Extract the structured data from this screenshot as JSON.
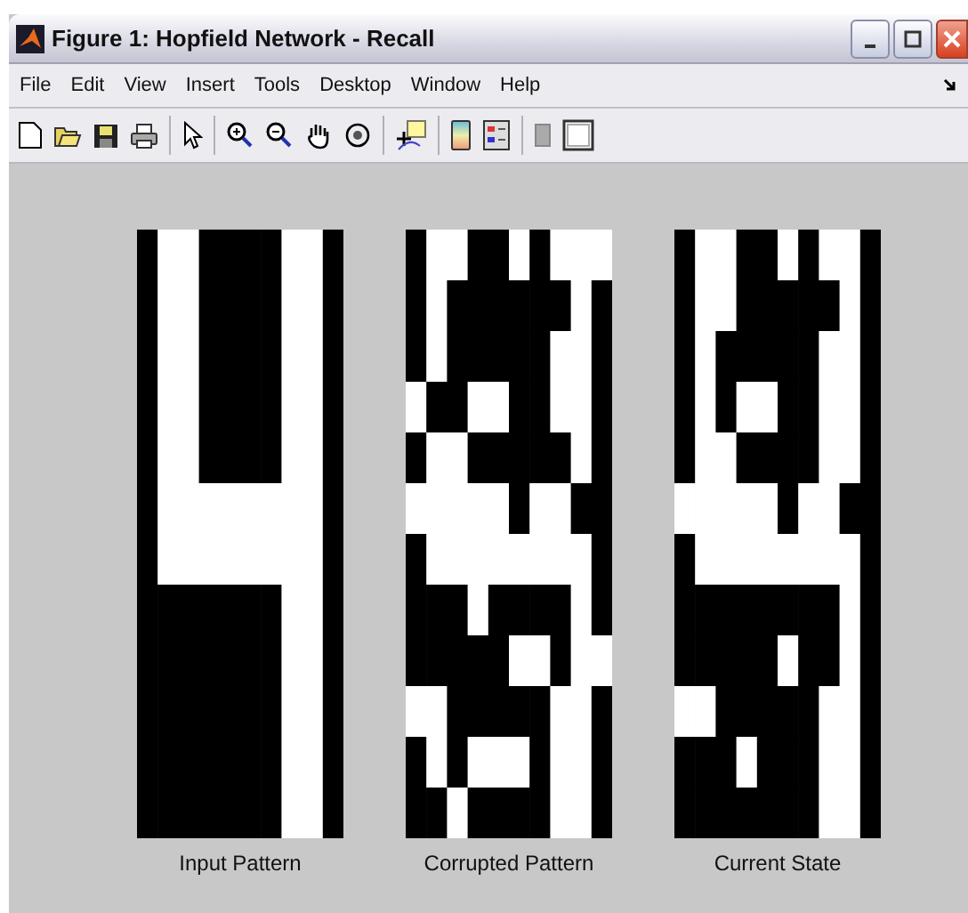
{
  "window": {
    "title": "Figure 1: Hopfield Network - Recall"
  },
  "menu": [
    "File",
    "Edit",
    "View",
    "Insert",
    "Tools",
    "Desktop",
    "Window",
    "Help"
  ],
  "patterns": [
    {
      "label": "Input Pattern",
      "pixels": [
        [
          false,
          true,
          true,
          false,
          false,
          false,
          false,
          true,
          true,
          false
        ],
        [
          false,
          true,
          true,
          false,
          false,
          false,
          false,
          true,
          true,
          false
        ],
        [
          false,
          true,
          true,
          false,
          false,
          false,
          false,
          true,
          true,
          false
        ],
        [
          false,
          true,
          true,
          false,
          false,
          false,
          false,
          true,
          true,
          false
        ],
        [
          false,
          true,
          true,
          false,
          false,
          false,
          false,
          true,
          true,
          false
        ],
        [
          false,
          true,
          true,
          true,
          true,
          true,
          true,
          true,
          true,
          false
        ],
        [
          false,
          true,
          true,
          true,
          true,
          true,
          true,
          true,
          true,
          false
        ],
        [
          false,
          false,
          false,
          false,
          false,
          false,
          false,
          true,
          true,
          false
        ],
        [
          false,
          false,
          false,
          false,
          false,
          false,
          false,
          true,
          true,
          false
        ],
        [
          false,
          false,
          false,
          false,
          false,
          false,
          false,
          true,
          true,
          false
        ],
        [
          false,
          false,
          false,
          false,
          false,
          false,
          false,
          true,
          true,
          false
        ],
        [
          false,
          false,
          false,
          false,
          false,
          false,
          false,
          true,
          true,
          false
        ]
      ]
    },
    {
      "label": "Corrupted Pattern",
      "pixels": [
        [
          false,
          true,
          true,
          false,
          false,
          true,
          false,
          true,
          true,
          true
        ],
        [
          false,
          true,
          false,
          false,
          false,
          false,
          false,
          false,
          true,
          false
        ],
        [
          false,
          true,
          false,
          false,
          false,
          false,
          false,
          true,
          true,
          false
        ],
        [
          true,
          false,
          false,
          true,
          true,
          false,
          false,
          true,
          true,
          false
        ],
        [
          false,
          true,
          true,
          false,
          false,
          false,
          false,
          false,
          true,
          false
        ],
        [
          true,
          true,
          true,
          true,
          true,
          false,
          true,
          true,
          false,
          false
        ],
        [
          false,
          true,
          true,
          true,
          true,
          true,
          true,
          true,
          true,
          false
        ],
        [
          false,
          false,
          false,
          true,
          false,
          false,
          false,
          false,
          true,
          false
        ],
        [
          false,
          false,
          false,
          false,
          false,
          true,
          true,
          false,
          true,
          true
        ],
        [
          true,
          true,
          false,
          false,
          false,
          false,
          false,
          true,
          true,
          false
        ],
        [
          false,
          true,
          false,
          true,
          true,
          true,
          false,
          true,
          true,
          false
        ],
        [
          false,
          false,
          true,
          false,
          false,
          false,
          false,
          true,
          true,
          false
        ]
      ]
    },
    {
      "label": "Current State",
      "pixels": [
        [
          false,
          true,
          true,
          false,
          false,
          true,
          false,
          true,
          true,
          false
        ],
        [
          false,
          true,
          true,
          false,
          false,
          false,
          false,
          false,
          true,
          false
        ],
        [
          false,
          true,
          false,
          false,
          false,
          false,
          false,
          true,
          true,
          false
        ],
        [
          false,
          true,
          false,
          true,
          true,
          false,
          false,
          true,
          true,
          false
        ],
        [
          false,
          true,
          true,
          false,
          false,
          false,
          false,
          true,
          true,
          false
        ],
        [
          true,
          true,
          true,
          true,
          true,
          false,
          true,
          true,
          false,
          false
        ],
        [
          false,
          true,
          true,
          true,
          true,
          true,
          true,
          true,
          true,
          false
        ],
        [
          false,
          false,
          false,
          false,
          false,
          false,
          false,
          false,
          true,
          false
        ],
        [
          false,
          false,
          false,
          false,
          false,
          true,
          false,
          false,
          true,
          false
        ],
        [
          true,
          true,
          false,
          false,
          false,
          false,
          false,
          true,
          true,
          false
        ],
        [
          false,
          false,
          false,
          true,
          false,
          false,
          false,
          true,
          true,
          false
        ],
        [
          false,
          false,
          false,
          false,
          false,
          false,
          false,
          true,
          true,
          false
        ]
      ]
    }
  ]
}
